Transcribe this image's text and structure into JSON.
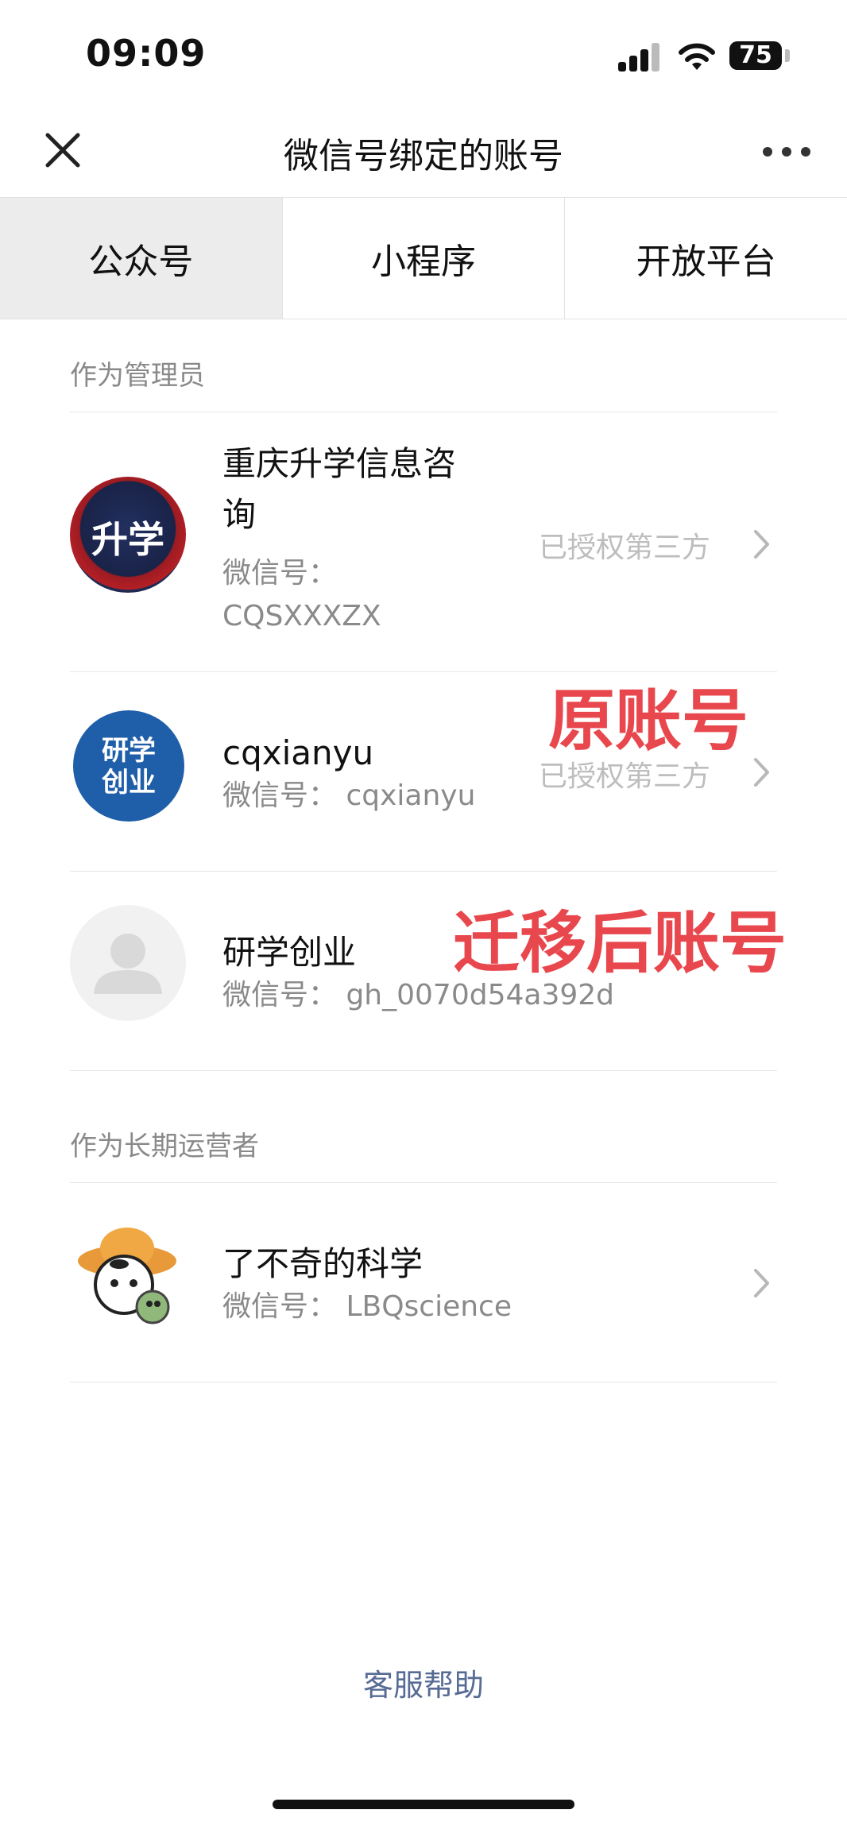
{
  "status_bar": {
    "time": "09:09",
    "battery": "75"
  },
  "nav": {
    "title": "微信号绑定的账号"
  },
  "tabs": [
    {
      "label": "公众号",
      "active": true
    },
    {
      "label": "小程序",
      "active": false
    },
    {
      "label": "开放平台",
      "active": false
    }
  ],
  "sections": {
    "admin": {
      "label": "作为管理员",
      "accounts": [
        {
          "name_line1": "重庆升学信息咨",
          "name_line2": "询",
          "wxid_prefix": "微信号：",
          "wxid": "CQSXXXZX",
          "status": "已授权第三方",
          "avatar_text": "升学"
        },
        {
          "name": "cqxianyu",
          "wxid_label": "微信号： cqxianyu",
          "status": "已授权第三方",
          "avatar_text_top": "研学",
          "avatar_text_bottom": "创业"
        },
        {
          "name": "研学创业",
          "wxid_label": "微信号： gh_0070d54a392d"
        }
      ]
    },
    "operator": {
      "label": "作为长期运营者",
      "accounts": [
        {
          "name": "了不奇的科学",
          "wxid_label": "微信号： LBQscience"
        }
      ]
    }
  },
  "annotations": {
    "original": "原账号",
    "migrated": "迁移后账号"
  },
  "footer": {
    "help": "客服帮助"
  },
  "colors": {
    "annotation": "#e8484d",
    "link": "#576b95",
    "tab_active_bg": "#ececec"
  }
}
